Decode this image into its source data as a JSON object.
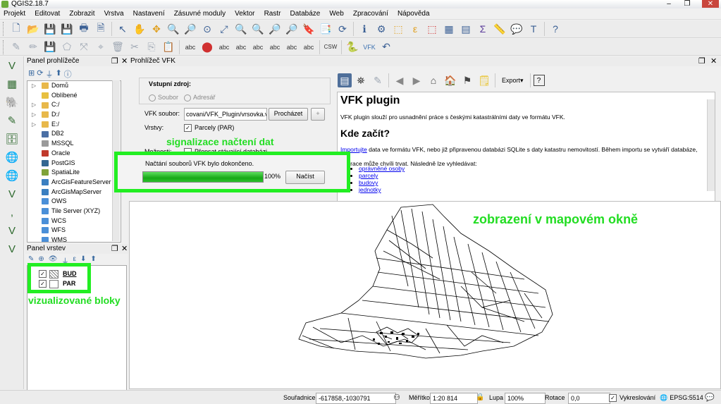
{
  "window": {
    "title": "QGIS2.18.7",
    "min": "–",
    "max": "❐",
    "close": "✕"
  },
  "menubar": [
    "Projekt",
    "Editovat",
    "Zobrazit",
    "Vrstva",
    "Nastavení",
    "Zásuvné moduly",
    "Vektor",
    "Rastr",
    "Databáze",
    "Web",
    "Zpracování",
    "Nápověda"
  ],
  "browser_panel": {
    "title": "Panel prohlížeče",
    "items": [
      {
        "label": "Domů",
        "icon": "folder-icon",
        "color": "#e8b84a",
        "expand": true
      },
      {
        "label": "Oblíbené",
        "icon": "star-icon",
        "color": "#e8c040",
        "expand": false
      },
      {
        "label": "C:/",
        "icon": "folder-icon",
        "color": "#e8b84a",
        "expand": true
      },
      {
        "label": "D:/",
        "icon": "folder-icon",
        "color": "#e8b84a",
        "expand": true
      },
      {
        "label": "E:/",
        "icon": "folder-icon",
        "color": "#e8b84a",
        "expand": true
      },
      {
        "label": "DB2",
        "icon": "db2-icon",
        "color": "#4a6fa5",
        "expand": false
      },
      {
        "label": "MSSQL",
        "icon": "mssql-icon",
        "color": "#9a9a9a",
        "expand": false
      },
      {
        "label": "Oracle",
        "icon": "oracle-icon",
        "color": "#c0392b",
        "expand": false
      },
      {
        "label": "PostGIS",
        "icon": "postgis-icon",
        "color": "#336791",
        "expand": false
      },
      {
        "label": "SpatiaLite",
        "icon": "spatialite-icon",
        "color": "#7fa33a",
        "expand": false
      },
      {
        "label": "ArcGisFeatureServer",
        "icon": "arcgis-icon",
        "color": "#3a7fc1",
        "expand": false
      },
      {
        "label": "ArcGisMapServer",
        "icon": "arcgis-icon",
        "color": "#3a7fc1",
        "expand": false
      },
      {
        "label": "OWS",
        "icon": "globe-icon",
        "color": "#4a8fd8",
        "expand": false
      },
      {
        "label": "Tile Server (XYZ)",
        "icon": "globe-icon",
        "color": "#4a8fd8",
        "expand": false
      },
      {
        "label": "WCS",
        "icon": "globe-icon",
        "color": "#4a8fd8",
        "expand": false
      },
      {
        "label": "WFS",
        "icon": "globe-icon",
        "color": "#4a8fd8",
        "expand": false
      },
      {
        "label": "WMS",
        "icon": "globe-icon",
        "color": "#4a8fd8",
        "expand": false
      }
    ]
  },
  "layers_panel": {
    "title": "Panel vrstev",
    "layers": [
      {
        "name": "BUD",
        "checked": true
      },
      {
        "name": "PAR",
        "checked": true
      }
    ]
  },
  "vfk_panel": {
    "title": "Prohlížeč VFK",
    "source_group_title": "Vstupní zdroj:",
    "radio_file": "Soubor",
    "radio_address": "Adresář",
    "file_label": "VFK soubor:",
    "file_value": "covani/VFK_Plugin/vrsovka.vfk",
    "browse_button": "Procházet",
    "add_button": "+",
    "layers_label": "Vrstvy:",
    "layer_option": "Parcely (PAR)",
    "options_label": "Možnosti:",
    "options_checkbox": "Přepsat stávající databázi",
    "load_status": "Načtání souborů VFK bylo dokončeno.",
    "progress_percent": 100,
    "progress_text": "100%",
    "load_button": "Načíst"
  },
  "doc": {
    "export_label": "Export",
    "help_label": "?",
    "title": "VFK plugin",
    "intro": "VFK plugin slouží pro usnadnění práce s českými katastrálními daty ve formátu VFK.",
    "heading": "Kde začít?",
    "import_link": "Importujte",
    "import_text": " data ve formátu VFK, nebo již připravenou databázi SQLite s daty katastru nemovitostí. Během importu se vytváří databáze, tato",
    "import_text2": "operace může chvíli trvat. Následně lze vyhledávat:",
    "links": [
      "oprávněné osoby",
      "parcely",
      "budovy",
      "jednotky"
    ]
  },
  "annotations": {
    "progress_note": "signalizace načtení dat",
    "map_note": "zobrazení v mapovém okně",
    "layers_note": "vizualizované bloky"
  },
  "statusbar": {
    "coord_label": "Souřadnice",
    "coord_value": "-617858,-1030791",
    "scale_label": "Měřítko",
    "scale_value": "1:20 814",
    "zoom_label": "Lupa",
    "zoom_value": "100%",
    "rotation_label": "Rotace",
    "rotation_value": "0,0",
    "render_label": "Vykreslování",
    "crs_label": "EPSG:5514"
  },
  "colors": {
    "highlight": "#22ee22",
    "progress": "#18a818"
  }
}
